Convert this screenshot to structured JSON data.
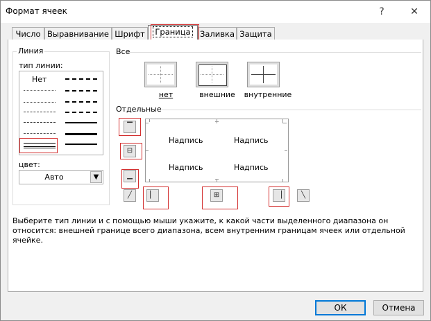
{
  "window": {
    "title": "Формат ячеек",
    "help": "?",
    "close": "✕"
  },
  "tabs": [
    {
      "label": "Число"
    },
    {
      "label": "Выравнивание"
    },
    {
      "label": "Шрифт"
    },
    {
      "label": "Граница"
    },
    {
      "label": "Заливка"
    },
    {
      "label": "Защита"
    }
  ],
  "line_section": {
    "group_title": "Линия",
    "style_label": "тип линии:",
    "none_label": "Нет",
    "color_label": "цвет:",
    "color_value": "Авто"
  },
  "presets": {
    "title": "Все",
    "items": [
      {
        "label": "нет"
      },
      {
        "label": "внешние"
      },
      {
        "label": "внутренние"
      }
    ]
  },
  "borders": {
    "title": "Отдельные",
    "preview_text": [
      "Надпись",
      "Надпись",
      "Надпись",
      "Надпись"
    ]
  },
  "description": "Выберите тип линии и с помощью мыши укажите, к какой части выделенного диапазона он относится: внешней границе всего диапазона, всем внутренним границам ячеек или отдельной ячейке.",
  "footer": {
    "ok": "ОК",
    "cancel": "Отмена"
  },
  "colors": {
    "highlight": "#d32f2f",
    "accent": "#0078d7"
  }
}
